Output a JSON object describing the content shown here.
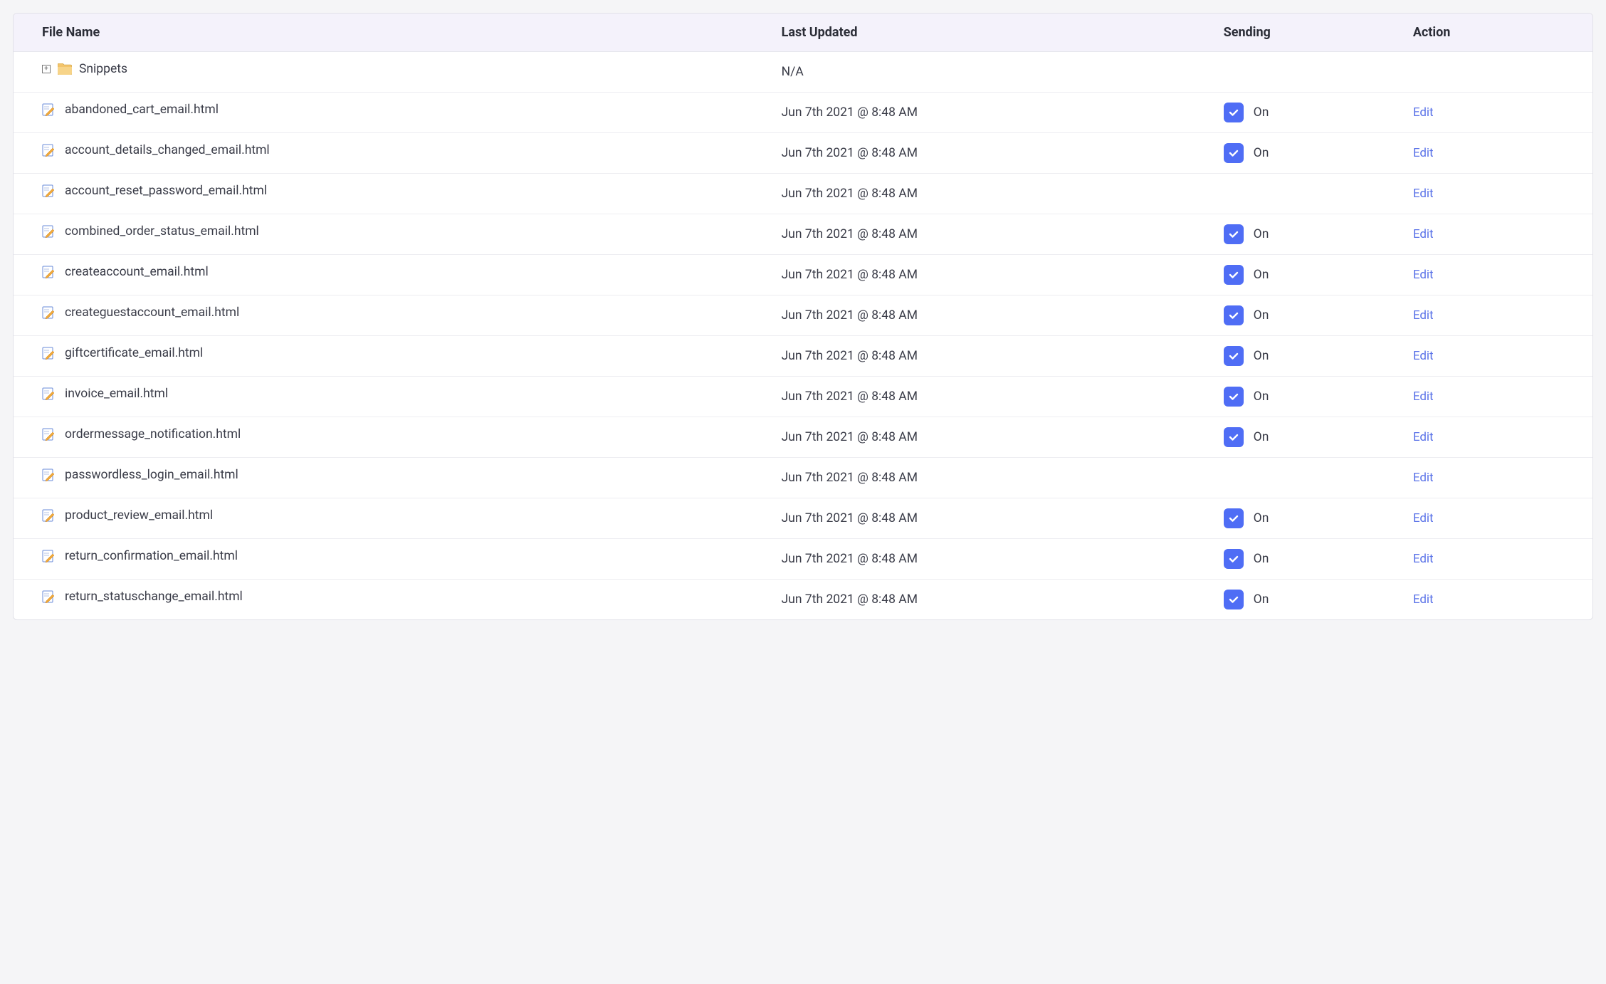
{
  "columns": {
    "file": "File Name",
    "updated": "Last Updated",
    "sending": "Sending",
    "action": "Action"
  },
  "folder": {
    "name": "Snippets",
    "updated": "N/A"
  },
  "sending_on_label": "On",
  "edit_label": "Edit",
  "rows": [
    {
      "name": "abandoned_cart_email.html",
      "updated": "Jun 7th 2021 @ 8:48 AM",
      "sending": true
    },
    {
      "name": "account_details_changed_email.html",
      "updated": "Jun 7th 2021 @ 8:48 AM",
      "sending": true
    },
    {
      "name": "account_reset_password_email.html",
      "updated": "Jun 7th 2021 @ 8:48 AM",
      "sending": false
    },
    {
      "name": "combined_order_status_email.html",
      "updated": "Jun 7th 2021 @ 8:48 AM",
      "sending": true
    },
    {
      "name": "createaccount_email.html",
      "updated": "Jun 7th 2021 @ 8:48 AM",
      "sending": true
    },
    {
      "name": "createguestaccount_email.html",
      "updated": "Jun 7th 2021 @ 8:48 AM",
      "sending": true
    },
    {
      "name": "giftcertificate_email.html",
      "updated": "Jun 7th 2021 @ 8:48 AM",
      "sending": true
    },
    {
      "name": "invoice_email.html",
      "updated": "Jun 7th 2021 @ 8:48 AM",
      "sending": true
    },
    {
      "name": "ordermessage_notification.html",
      "updated": "Jun 7th 2021 @ 8:48 AM",
      "sending": true
    },
    {
      "name": "passwordless_login_email.html",
      "updated": "Jun 7th 2021 @ 8:48 AM",
      "sending": false
    },
    {
      "name": "product_review_email.html",
      "updated": "Jun 7th 2021 @ 8:48 AM",
      "sending": true
    },
    {
      "name": "return_confirmation_email.html",
      "updated": "Jun 7th 2021 @ 8:48 AM",
      "sending": true
    },
    {
      "name": "return_statuschange_email.html",
      "updated": "Jun 7th 2021 @ 8:48 AM",
      "sending": true
    }
  ]
}
